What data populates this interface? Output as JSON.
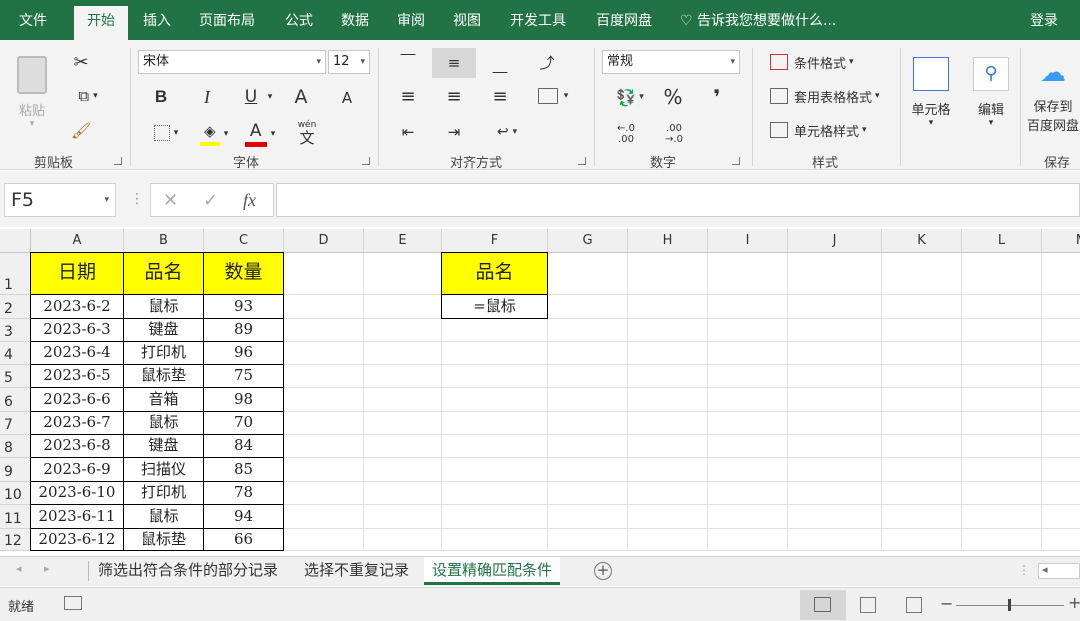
{
  "ribbon_tabs": [
    {
      "label": "文件",
      "active": false
    },
    {
      "label": "开始",
      "active": true
    },
    {
      "label": "插入",
      "active": false
    },
    {
      "label": "页面布局",
      "active": false
    },
    {
      "label": "公式",
      "active": false
    },
    {
      "label": "数据",
      "active": false
    },
    {
      "label": "审阅",
      "active": false
    },
    {
      "label": "视图",
      "active": false
    },
    {
      "label": "开发工具",
      "active": false
    },
    {
      "label": "百度网盘",
      "active": false
    }
  ],
  "tell_me": "告诉我您想要做什么...",
  "login": "登录",
  "clipboard": {
    "paste": "粘贴",
    "group": "剪贴板"
  },
  "font": {
    "name": "宋体",
    "size": "12",
    "group": "字体",
    "bold": "B",
    "italic": "I",
    "underline": "U",
    "grow": "A",
    "shrink": "A",
    "font_color": "A",
    "wen": "wén",
    "wen_char": "文"
  },
  "alignment": {
    "group": "对齐方式"
  },
  "number": {
    "format": "常规",
    "group": "数字",
    "percent": "%",
    "comma": "❜",
    "inc_decimal": "←.0\n.00",
    "dec_decimal": ".00\n→.0"
  },
  "styles": {
    "conditional": "条件格式",
    "table": "套用表格格式",
    "cell": "单元格样式",
    "group": "样式"
  },
  "cells": {
    "label": "单元格"
  },
  "editing": {
    "label": "编辑"
  },
  "save": {
    "label": "保存到",
    "label2": "百度网盘",
    "group": "保存"
  },
  "formula_bar": {
    "name_box": "F5",
    "fx": "fx",
    "formula": ""
  },
  "columns": [
    "A",
    "B",
    "C",
    "D",
    "E",
    "F",
    "G",
    "H",
    "I",
    "J",
    "K",
    "L",
    "M"
  ],
  "rows": [
    "1",
    "2",
    "3",
    "4",
    "5",
    "6",
    "7",
    "8",
    "9",
    "10",
    "11",
    "12"
  ],
  "table": {
    "headers": [
      "日期",
      "品名",
      "数量"
    ],
    "rows": [
      [
        "2023-6-2",
        "鼠标",
        "93"
      ],
      [
        "2023-6-3",
        "键盘",
        "89"
      ],
      [
        "2023-6-4",
        "打印机",
        "96"
      ],
      [
        "2023-6-5",
        "鼠标垫",
        "75"
      ],
      [
        "2023-6-6",
        "音箱",
        "98"
      ],
      [
        "2023-6-7",
        "鼠标",
        "70"
      ],
      [
        "2023-6-8",
        "键盘",
        "84"
      ],
      [
        "2023-6-9",
        "扫描仪",
        "85"
      ],
      [
        "2023-6-10",
        "打印机",
        "78"
      ],
      [
        "2023-6-11",
        "鼠标",
        "94"
      ],
      [
        "2023-6-12",
        "鼠标垫",
        "66"
      ]
    ]
  },
  "criteria": {
    "header": "品名",
    "value": "=鼠标"
  },
  "sheet_tabs": [
    {
      "label": "筛选出符合条件的部分记录",
      "active": false
    },
    {
      "label": "选择不重复记录",
      "active": false
    },
    {
      "label": "设置精确匹配条件",
      "active": true
    }
  ],
  "status": {
    "ready": "就绪"
  },
  "colors": {
    "accent": "#217346",
    "highlight": "#ffff00",
    "font_red": "#e00000"
  }
}
